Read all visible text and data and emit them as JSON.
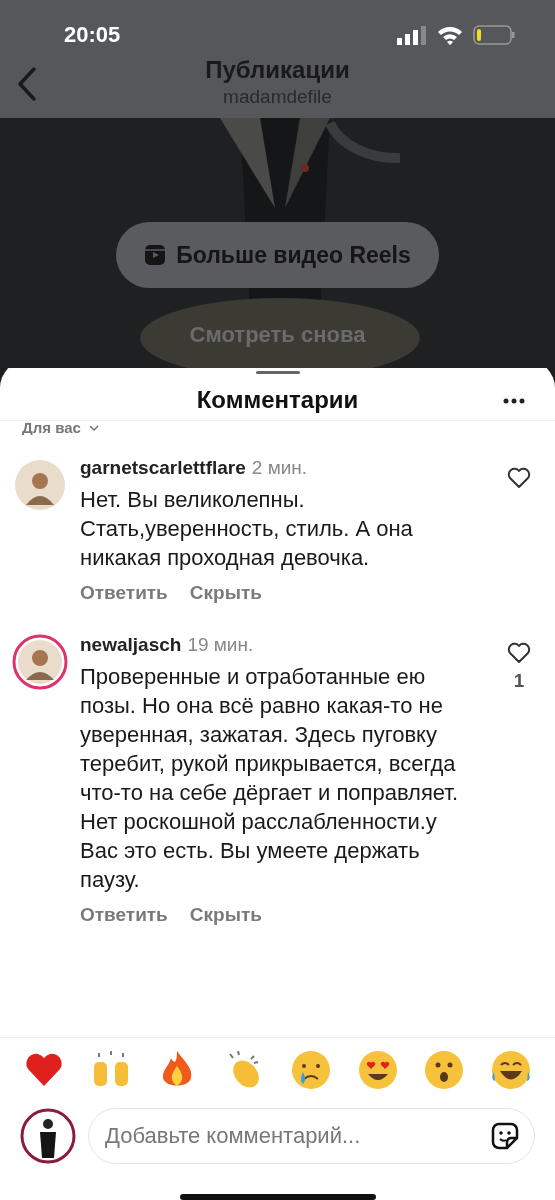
{
  "status_bar": {
    "time": "20:05"
  },
  "header": {
    "title": "Публикации",
    "subtitle": "madamdefile"
  },
  "video": {
    "reels_button": "Больше видео Reels",
    "replay": "Смотреть снова"
  },
  "comments_sheet": {
    "title": "Комментарии",
    "sort": "Для вас",
    "comments": [
      {
        "user": "garnetscarlettflare",
        "time": "2 мин.",
        "text": "Нет. Вы великолепны. Стать,уверенность, стиль. А она никакая проходная девочка.",
        "reply": "Ответить",
        "hide": "Скрыть",
        "story_ring": false
      },
      {
        "user": "newaljasch",
        "time": "19 мин.",
        "text": "Проверенные и отработанные ею позы. Но она всё равно какая-то не уверенная, зажатая. Здесь пуговку теребит, рукой прикрывается, всегда что-то на себе дёргает и поправляет. Нет роскошной расслабленности.у Вас это есть. Вы умеете держать паузу.",
        "reply": "Ответить",
        "hide": "Скрыть",
        "story_ring": true,
        "likes": "1"
      }
    ],
    "comment_input": {
      "placeholder": "Добавьте комментарий..."
    }
  }
}
